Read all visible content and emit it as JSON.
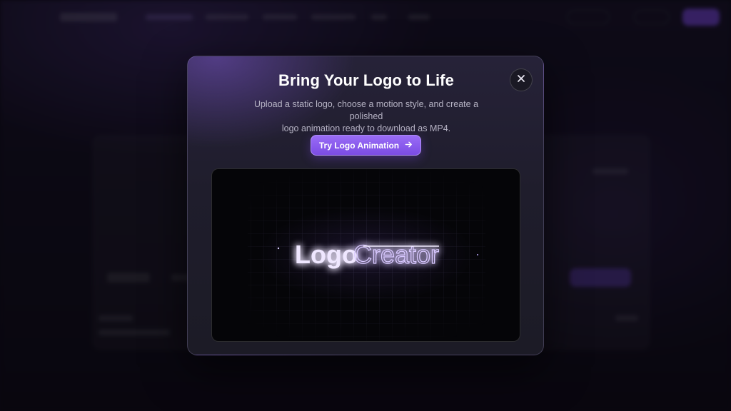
{
  "modal": {
    "title": "Bring Your Logo to Life",
    "description_line1": "Upload a static logo, choose a motion style, and create a polished",
    "description_line2": "logo animation ready to download as MP4.",
    "cta_label": "Try Logo Animation",
    "cta_icon": "arrow-right-icon",
    "close_icon": "close-icon"
  },
  "preview": {
    "logo_word_1": "Logo",
    "logo_word_2": "Creator"
  },
  "colors": {
    "accent": "#8b5cf6",
    "modal_bg": "#1f1d2c",
    "text_primary": "#ffffff",
    "text_secondary": "#b6b3c4",
    "logo_glow": "#c9b4ff"
  }
}
